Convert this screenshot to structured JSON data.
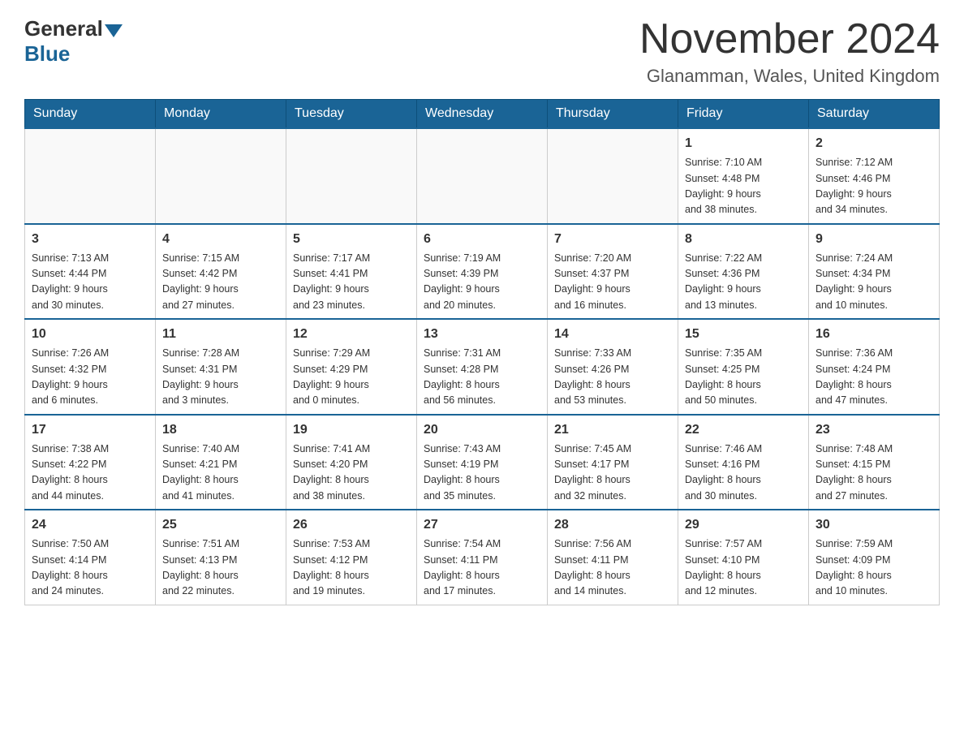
{
  "logo": {
    "general": "General",
    "blue": "Blue",
    "arrow": "▼"
  },
  "title": "November 2024",
  "location": "Glanamman, Wales, United Kingdom",
  "days_header": [
    "Sunday",
    "Monday",
    "Tuesday",
    "Wednesday",
    "Thursday",
    "Friday",
    "Saturday"
  ],
  "weeks": [
    [
      {
        "day": "",
        "info": ""
      },
      {
        "day": "",
        "info": ""
      },
      {
        "day": "",
        "info": ""
      },
      {
        "day": "",
        "info": ""
      },
      {
        "day": "",
        "info": ""
      },
      {
        "day": "1",
        "info": "Sunrise: 7:10 AM\nSunset: 4:48 PM\nDaylight: 9 hours\nand 38 minutes."
      },
      {
        "day": "2",
        "info": "Sunrise: 7:12 AM\nSunset: 4:46 PM\nDaylight: 9 hours\nand 34 minutes."
      }
    ],
    [
      {
        "day": "3",
        "info": "Sunrise: 7:13 AM\nSunset: 4:44 PM\nDaylight: 9 hours\nand 30 minutes."
      },
      {
        "day": "4",
        "info": "Sunrise: 7:15 AM\nSunset: 4:42 PM\nDaylight: 9 hours\nand 27 minutes."
      },
      {
        "day": "5",
        "info": "Sunrise: 7:17 AM\nSunset: 4:41 PM\nDaylight: 9 hours\nand 23 minutes."
      },
      {
        "day": "6",
        "info": "Sunrise: 7:19 AM\nSunset: 4:39 PM\nDaylight: 9 hours\nand 20 minutes."
      },
      {
        "day": "7",
        "info": "Sunrise: 7:20 AM\nSunset: 4:37 PM\nDaylight: 9 hours\nand 16 minutes."
      },
      {
        "day": "8",
        "info": "Sunrise: 7:22 AM\nSunset: 4:36 PM\nDaylight: 9 hours\nand 13 minutes."
      },
      {
        "day": "9",
        "info": "Sunrise: 7:24 AM\nSunset: 4:34 PM\nDaylight: 9 hours\nand 10 minutes."
      }
    ],
    [
      {
        "day": "10",
        "info": "Sunrise: 7:26 AM\nSunset: 4:32 PM\nDaylight: 9 hours\nand 6 minutes."
      },
      {
        "day": "11",
        "info": "Sunrise: 7:28 AM\nSunset: 4:31 PM\nDaylight: 9 hours\nand 3 minutes."
      },
      {
        "day": "12",
        "info": "Sunrise: 7:29 AM\nSunset: 4:29 PM\nDaylight: 9 hours\nand 0 minutes."
      },
      {
        "day": "13",
        "info": "Sunrise: 7:31 AM\nSunset: 4:28 PM\nDaylight: 8 hours\nand 56 minutes."
      },
      {
        "day": "14",
        "info": "Sunrise: 7:33 AM\nSunset: 4:26 PM\nDaylight: 8 hours\nand 53 minutes."
      },
      {
        "day": "15",
        "info": "Sunrise: 7:35 AM\nSunset: 4:25 PM\nDaylight: 8 hours\nand 50 minutes."
      },
      {
        "day": "16",
        "info": "Sunrise: 7:36 AM\nSunset: 4:24 PM\nDaylight: 8 hours\nand 47 minutes."
      }
    ],
    [
      {
        "day": "17",
        "info": "Sunrise: 7:38 AM\nSunset: 4:22 PM\nDaylight: 8 hours\nand 44 minutes."
      },
      {
        "day": "18",
        "info": "Sunrise: 7:40 AM\nSunset: 4:21 PM\nDaylight: 8 hours\nand 41 minutes."
      },
      {
        "day": "19",
        "info": "Sunrise: 7:41 AM\nSunset: 4:20 PM\nDaylight: 8 hours\nand 38 minutes."
      },
      {
        "day": "20",
        "info": "Sunrise: 7:43 AM\nSunset: 4:19 PM\nDaylight: 8 hours\nand 35 minutes."
      },
      {
        "day": "21",
        "info": "Sunrise: 7:45 AM\nSunset: 4:17 PM\nDaylight: 8 hours\nand 32 minutes."
      },
      {
        "day": "22",
        "info": "Sunrise: 7:46 AM\nSunset: 4:16 PM\nDaylight: 8 hours\nand 30 minutes."
      },
      {
        "day": "23",
        "info": "Sunrise: 7:48 AM\nSunset: 4:15 PM\nDaylight: 8 hours\nand 27 minutes."
      }
    ],
    [
      {
        "day": "24",
        "info": "Sunrise: 7:50 AM\nSunset: 4:14 PM\nDaylight: 8 hours\nand 24 minutes."
      },
      {
        "day": "25",
        "info": "Sunrise: 7:51 AM\nSunset: 4:13 PM\nDaylight: 8 hours\nand 22 minutes."
      },
      {
        "day": "26",
        "info": "Sunrise: 7:53 AM\nSunset: 4:12 PM\nDaylight: 8 hours\nand 19 minutes."
      },
      {
        "day": "27",
        "info": "Sunrise: 7:54 AM\nSunset: 4:11 PM\nDaylight: 8 hours\nand 17 minutes."
      },
      {
        "day": "28",
        "info": "Sunrise: 7:56 AM\nSunset: 4:11 PM\nDaylight: 8 hours\nand 14 minutes."
      },
      {
        "day": "29",
        "info": "Sunrise: 7:57 AM\nSunset: 4:10 PM\nDaylight: 8 hours\nand 12 minutes."
      },
      {
        "day": "30",
        "info": "Sunrise: 7:59 AM\nSunset: 4:09 PM\nDaylight: 8 hours\nand 10 minutes."
      }
    ]
  ]
}
